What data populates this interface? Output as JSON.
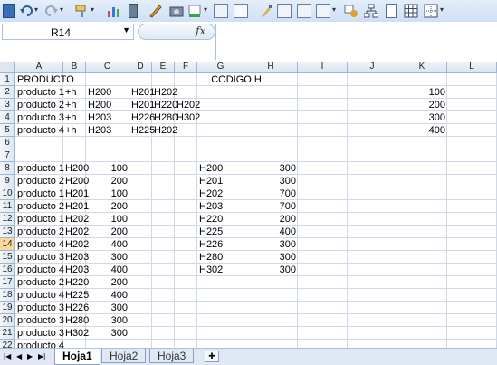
{
  "toolbar": {
    "icons": [
      "save-icon",
      "undo-icon",
      "redo-icon",
      "format-painter-icon",
      "chart-icon",
      "calculator-icon",
      "edit-icon",
      "camera-icon",
      "fill-icon",
      "paste-icon",
      "sort-icon",
      "brush-icon",
      "form-icon",
      "text-box-icon",
      "merge-icon",
      "shapes-icon",
      "org-chart-icon",
      "blank-page-icon",
      "grid-icon",
      "borders-icon"
    ]
  },
  "formula_bar": {
    "name_box": "R14",
    "fx_label": "fx",
    "formula": ""
  },
  "grid": {
    "columns": [
      "A",
      "B",
      "C",
      "D",
      "E",
      "F",
      "G",
      "H",
      "I",
      "J",
      "K",
      "L"
    ],
    "rows": [
      "1",
      "2",
      "3",
      "4",
      "5",
      "6",
      "7",
      "8",
      "9",
      "10",
      "11",
      "12",
      "13",
      "14",
      "15",
      "16",
      "17",
      "18",
      "19",
      "20",
      "21",
      "22"
    ],
    "active_row": "14",
    "cells": {
      "A1": "PRODUCTO",
      "F1": "CODIGO H",
      "A2": "producto 1",
      "B2": "+h",
      "C2": "H200",
      "D2": "H201",
      "E2": "H202",
      "K2": "100",
      "A3": "producto 2",
      "B3": "+h",
      "C3": "H200",
      "D3": "H201",
      "E3": "H220",
      "F3": "H202",
      "K3": "200",
      "A4": "producto 3",
      "B4": "+h",
      "C4": "H203",
      "D4": "H226",
      "E4": "H280",
      "F4": "H302",
      "K4": "300",
      "A5": "producto 4",
      "B5": "+h",
      "C5": "H203",
      "D5": "H225",
      "E5": "H202",
      "K5": "400",
      "A8": "producto 1",
      "B8": "H200",
      "C8": "100",
      "G8": "H200",
      "H8": "300",
      "A9": "producto 2",
      "B9": "H200",
      "C9": "200",
      "G9": "H201",
      "H9": "300",
      "A10": "producto 1",
      "B10": "H201",
      "C10": "100",
      "G10": "H202",
      "H10": "700",
      "A11": "producto 2",
      "B11": "H201",
      "C11": "200",
      "G11": "H203",
      "H11": "700",
      "A12": "producto 1",
      "B12": "H202",
      "C12": "100",
      "G12": "H220",
      "H12": "200",
      "A13": "producto 2",
      "B13": "H202",
      "C13": "200",
      "G13": "H225",
      "H13": "400",
      "A14": "producto 4",
      "B14": "H202",
      "C14": "400",
      "G14": "H226",
      "H14": "300",
      "A15": "producto 3",
      "B15": "H203",
      "C15": "300",
      "G15": "H280",
      "H15": "300",
      "A16": "producto 4",
      "B16": "H203",
      "C16": "400",
      "G16": "H302",
      "H16": "300",
      "A17": "producto 2",
      "B17": "H220",
      "C17": "200",
      "A18": "producto 4",
      "B18": "H225",
      "C18": "400",
      "A19": "producto 3",
      "B19": "H226",
      "C19": "300",
      "A20": "producto 3",
      "B20": "H280",
      "C20": "300",
      "A21": "producto 3",
      "B21": "H302",
      "C21": "300",
      "A22": "producto 4"
    }
  },
  "sheet_tabs": {
    "tabs": [
      "Hoja1",
      "Hoja2",
      "Hoja3"
    ],
    "active": "Hoja1"
  }
}
